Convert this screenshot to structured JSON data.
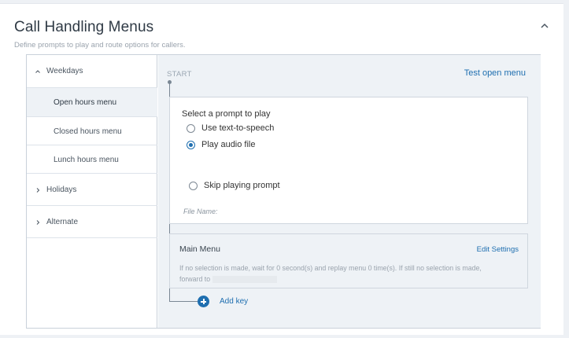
{
  "header": {
    "title": "Call Handling Menus",
    "subtitle": "Define prompts to play and route options for callers."
  },
  "sidebar": {
    "groups": [
      {
        "label": "Weekdays",
        "expanded": true,
        "items": [
          {
            "label": "Open hours menu",
            "active": true
          },
          {
            "label": "Closed hours menu",
            "active": false
          },
          {
            "label": "Lunch hours menu",
            "active": false
          }
        ]
      },
      {
        "label": "Holidays",
        "expanded": false
      },
      {
        "label": "Alternate",
        "expanded": false
      }
    ]
  },
  "main": {
    "start_label": "START",
    "test_link": "Test open menu",
    "prompt": {
      "heading": "Select a prompt to play",
      "options": [
        {
          "label": "Use text-to-speech",
          "selected": false
        },
        {
          "label": "Play audio file",
          "selected": true
        }
      ],
      "file_name_label": "File Name:",
      "skip_option": {
        "label": "Skip playing prompt",
        "selected": false
      }
    },
    "menu": {
      "title": "Main Menu",
      "edit_link": "Edit Settings",
      "description_line1": "If no selection is made, wait for 0 second(s) and replay menu 0 time(s). If still no selection is made,",
      "description_line2": "forward to"
    },
    "add_key": "Add key"
  },
  "colors": {
    "accent": "#1f6fb0",
    "panel_bg": "#eef2f6",
    "border": "#c9d1da"
  }
}
